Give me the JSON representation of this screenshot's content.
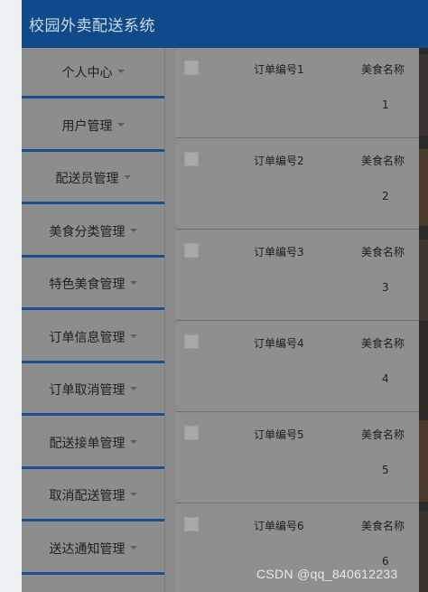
{
  "app": {
    "title": "校园外卖配送系统"
  },
  "sidebar": {
    "items": [
      {
        "label": "个人中心"
      },
      {
        "label": "用户管理"
      },
      {
        "label": "配送员管理"
      },
      {
        "label": "美食分类管理"
      },
      {
        "label": "特色美食管理"
      },
      {
        "label": "订单信息管理"
      },
      {
        "label": "订单取消管理"
      },
      {
        "label": "配送接单管理"
      },
      {
        "label": "取消配送管理"
      },
      {
        "label": "送达通知管理"
      }
    ]
  },
  "list": {
    "rows": [
      {
        "order_no": "订单编号1",
        "food_label": "美食名称",
        "food_value": "1"
      },
      {
        "order_no": "订单编号2",
        "food_label": "美食名称",
        "food_value": "2"
      },
      {
        "order_no": "订单编号3",
        "food_label": "美食名称",
        "food_value": "3"
      },
      {
        "order_no": "订单编号4",
        "food_label": "美食名称",
        "food_value": "4"
      },
      {
        "order_no": "订单编号5",
        "food_label": "美食名称",
        "food_value": "5"
      },
      {
        "order_no": "订单编号6",
        "food_label": "美食名称",
        "food_value": "6"
      }
    ]
  },
  "watermark": "CSDN @qq_840612233",
  "colors": {
    "header": "#0f4a8a",
    "menu_divider": "#1c4f8f",
    "overlay": "#8c8c8c"
  }
}
